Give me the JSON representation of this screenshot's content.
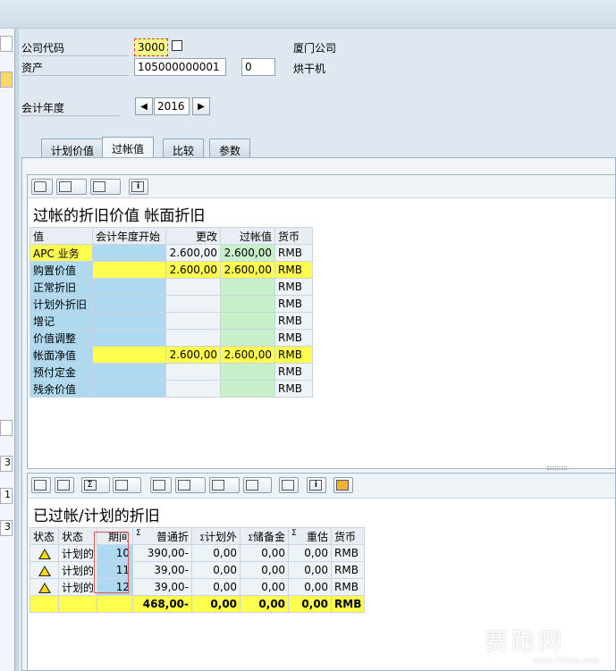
{
  "header": {
    "company_code_label": "公司代码",
    "company_code": "3000",
    "company_name": "厦门公司",
    "asset_label": "资产",
    "asset_number": "105000000001",
    "asset_sub": "0",
    "asset_desc": "烘干机",
    "fiscal_year_label": "会计年度",
    "fiscal_year": "2016"
  },
  "tabs": [
    "计划价值",
    "过帐值",
    "比较",
    "参数"
  ],
  "top_panel": {
    "title": "过帐的折旧价值 帐面折旧",
    "columns": [
      "值",
      "会计年度开始",
      "更改",
      "过帐值",
      "货币"
    ],
    "rows": [
      {
        "label": "APC 业务",
        "start": "",
        "change": "2.600,00",
        "posted": "2.600,00",
        "currency": "RMB",
        "hl": false
      },
      {
        "label": "购置价值",
        "start": "",
        "change": "2.600,00",
        "posted": "2.600,00",
        "currency": "RMB",
        "hl": true
      },
      {
        "label": "正常折旧",
        "start": "",
        "change": "",
        "posted": "",
        "currency": "RMB",
        "hl": false
      },
      {
        "label": "计划外折旧",
        "start": "",
        "change": "",
        "posted": "",
        "currency": "RMB",
        "hl": false
      },
      {
        "label": "增记",
        "start": "",
        "change": "",
        "posted": "",
        "currency": "RMB",
        "hl": false
      },
      {
        "label": "价值调整",
        "start": "",
        "change": "",
        "posted": "",
        "currency": "RMB",
        "hl": false
      },
      {
        "label": "帐面净值",
        "start": "",
        "change": "2.600,00",
        "posted": "2.600,00",
        "currency": "RMB",
        "hl": true
      },
      {
        "label": "预付定金",
        "start": "",
        "change": "",
        "posted": "",
        "currency": "RMB",
        "hl": false
      },
      {
        "label": "残余价值",
        "start": "",
        "change": "",
        "posted": "",
        "currency": "RMB",
        "hl": false
      }
    ]
  },
  "bottom_panel": {
    "title": "已过帐/计划的折旧",
    "columns": [
      "状态",
      "状态",
      "期间",
      "普通折",
      "计划外",
      "储备金",
      "重估",
      "货币"
    ],
    "rows": [
      {
        "status": "计划的",
        "period": "10",
        "ordinary": "390,00-",
        "unplanned": "0,00",
        "reserve": "0,00",
        "reval": "0,00",
        "currency": "RMB"
      },
      {
        "status": "计划的",
        "period": "11",
        "ordinary": "39,00-",
        "unplanned": "0,00",
        "reserve": "0,00",
        "reval": "0,00",
        "currency": "RMB"
      },
      {
        "status": "计划的",
        "period": "12",
        "ordinary": "39,00-",
        "unplanned": "0,00",
        "reserve": "0,00",
        "reval": "0,00",
        "currency": "RMB"
      }
    ],
    "total": {
      "ordinary": "468,00-",
      "unplanned": "0,00",
      "reserve": "0,00",
      "reval": "0,00",
      "currency": "RMB"
    }
  },
  "left_stub": [
    "3",
    "1",
    "3"
  ],
  "watermark": {
    "text": "赛跑网",
    "url": "www.915ap.com"
  }
}
